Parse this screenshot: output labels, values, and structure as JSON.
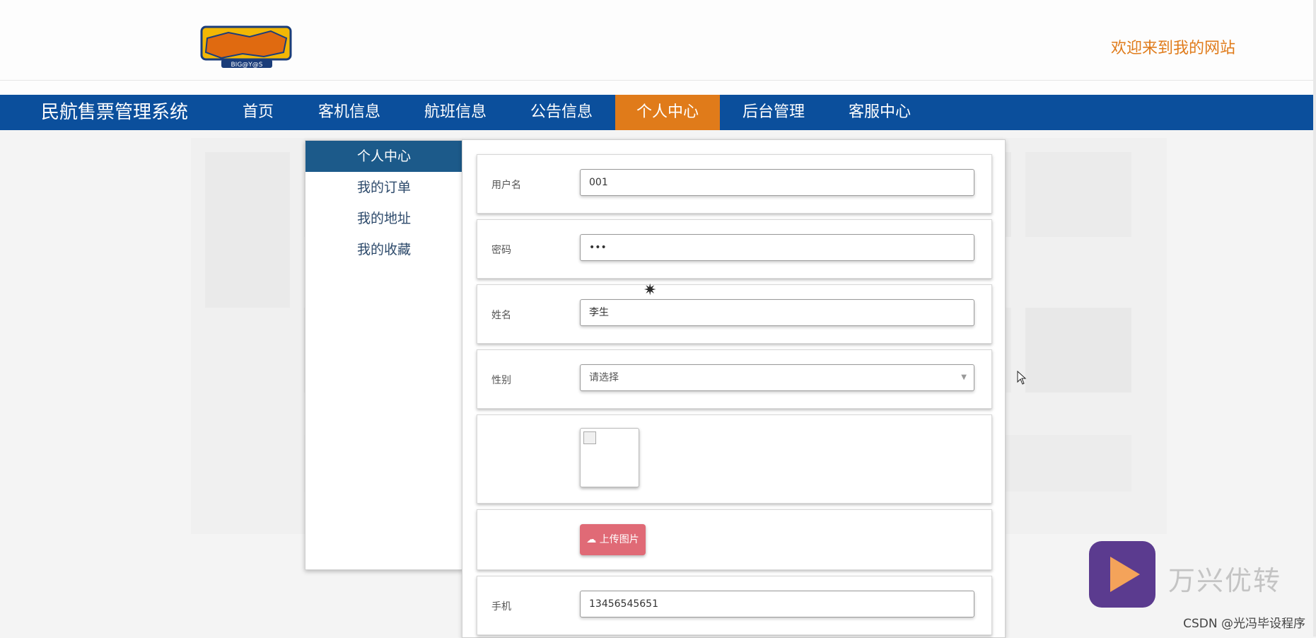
{
  "header": {
    "welcome": "欢迎来到我的网站",
    "logo_text": "BIG@Y@S"
  },
  "navbar": {
    "brand": "民航售票管理系统",
    "items": [
      {
        "label": "首页",
        "active": false
      },
      {
        "label": "客机信息",
        "active": false
      },
      {
        "label": "航班信息",
        "active": false
      },
      {
        "label": "公告信息",
        "active": false
      },
      {
        "label": "个人中心",
        "active": true
      },
      {
        "label": "后台管理",
        "active": false
      },
      {
        "label": "客服中心",
        "active": false
      }
    ],
    "colors": {
      "bar": "#0b4f9c",
      "active": "#e07b1a"
    }
  },
  "sidebar": {
    "items": [
      {
        "label": "个人中心",
        "active": true
      },
      {
        "label": "我的订单",
        "active": false
      },
      {
        "label": "我的地址",
        "active": false
      },
      {
        "label": "我的收藏",
        "active": false
      }
    ]
  },
  "form": {
    "username": {
      "label": "用户名",
      "value": "001"
    },
    "password": {
      "label": "密码",
      "value": "•••"
    },
    "name": {
      "label": "姓名",
      "value": "李生"
    },
    "gender": {
      "label": "性别",
      "placeholder": "请选择"
    },
    "avatar": {
      "icon": "broken-image-icon"
    },
    "upload": {
      "label": "上传图片",
      "icon": "cloud-upload-icon"
    },
    "phone": {
      "label": "手机",
      "value": "13456545651"
    }
  },
  "overlay": {
    "watermark_text": "万兴优转",
    "credit": "CSDN @光冯毕设程序"
  }
}
